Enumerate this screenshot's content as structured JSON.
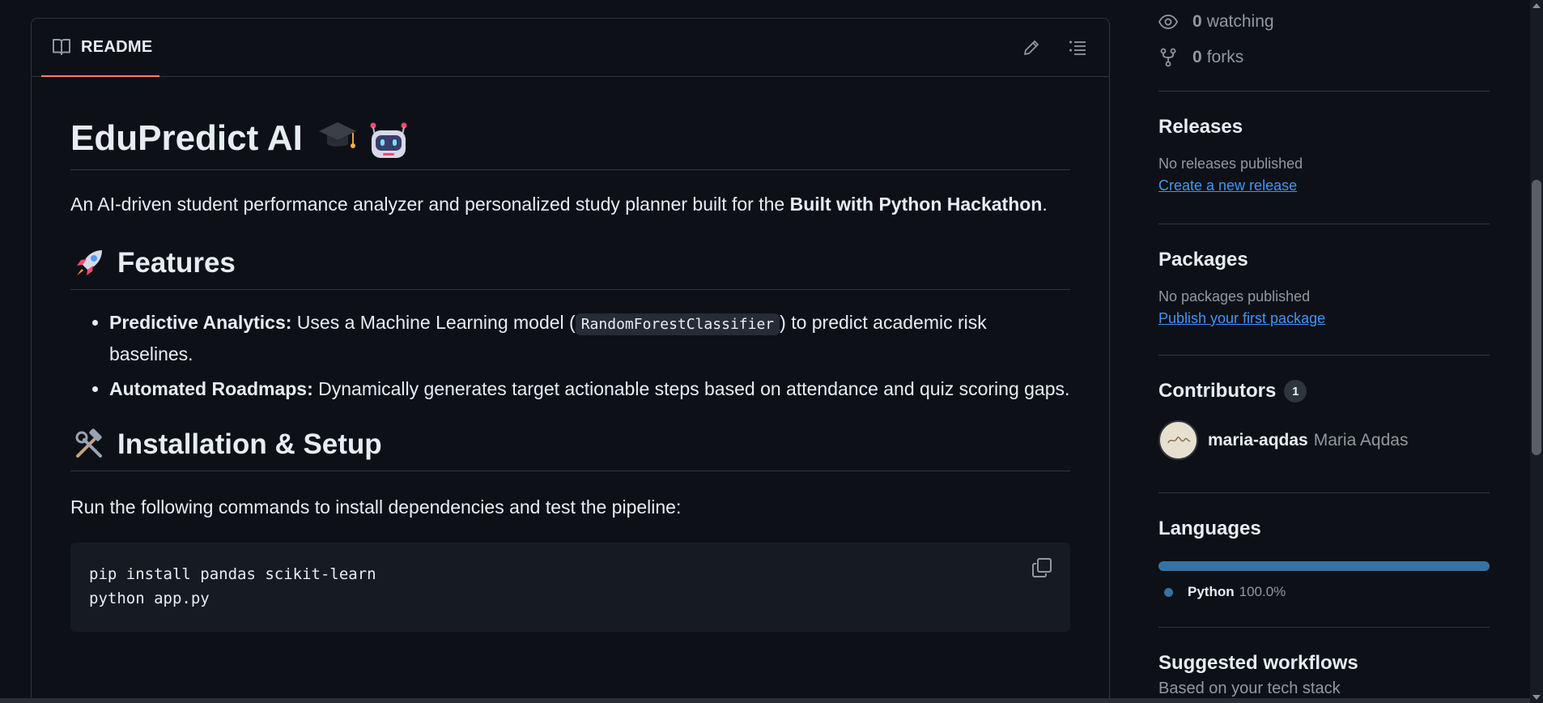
{
  "readme": {
    "tab_label": "README",
    "title": "EduPredict AI",
    "intro_text": "An AI-driven student performance analyzer and personalized study planner built for the ",
    "intro_bold": "Built with Python Hackathon",
    "intro_end": ".",
    "features_heading": "Features",
    "features": [
      {
        "label": "Predictive Analytics:",
        "text_before": " Uses a Machine Learning model (",
        "code": "RandomForestClassifier",
        "text_after": ") to predict academic risk baselines."
      },
      {
        "label": "Automated Roadmaps:",
        "text": " Dynamically generates target actionable steps based on attendance and quiz scoring gaps."
      }
    ],
    "install_heading": "Installation & Setup",
    "run_text": "Run the following commands to install dependencies and test the pipeline:",
    "code_lines": [
      "pip install pandas scikit-learn",
      "python app.py"
    ]
  },
  "sidebar": {
    "watching_count": "0",
    "watching_label": "watching",
    "forks_count": "0",
    "forks_label": "forks",
    "releases": {
      "heading": "Releases",
      "empty_text": "No releases published",
      "link": "Create a new release"
    },
    "packages": {
      "heading": "Packages",
      "empty_text": "No packages published",
      "link": "Publish your first package"
    },
    "contributors": {
      "heading": "Contributors",
      "count": "1",
      "login": "maria-aqdas",
      "name": "Maria Aqdas"
    },
    "languages": {
      "heading": "Languages",
      "items": [
        {
          "name": "Python",
          "percent": "100.0%",
          "fraction": 1.0,
          "color": "#3572a5"
        }
      ]
    },
    "suggested": {
      "heading": "Suggested workflows",
      "subtext": "Based on your tech stack"
    }
  }
}
